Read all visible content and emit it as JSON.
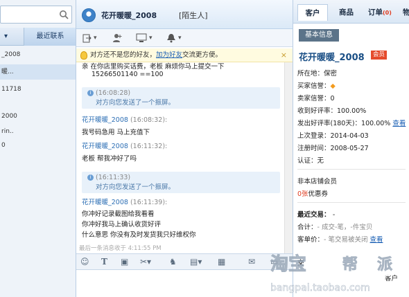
{
  "left": {
    "tab_recent": "最近联系",
    "contacts": [
      "_2008",
      "暖...",
      "11718",
      "2000",
      "rin..",
      "0"
    ]
  },
  "chat": {
    "name": "花开暖暖_2008",
    "tag": "[陌生人]",
    "notice_pre": "对方还不是您的好友，",
    "notice_link": "加为好友",
    "notice_post": "交流更方便。",
    "notice_close": "×",
    "partial_line": "亲  在你店里购买话费，老板   麻烦你马上提交一下",
    "messages": {
      "m0_text": "15266501140 ==100",
      "s1_time": "(16:08:28)",
      "s1_text": "对方向您发送了一个振屏。",
      "m1_sender": "花开暖暖_2008",
      "m1_time": "(16:08:32):",
      "m1_text": "我号码急用    马上充值下",
      "m2_sender": "花开暖暖_2008",
      "m2_time": "(16:11:32):",
      "m2_text": "老板    帮我冲好了吗",
      "s2_time": "(16:11:33)",
      "s2_text": "对方向您发送了一个振屏。",
      "m3_sender": "花开暖暖_2008",
      "m3_time": "(16:11:39):",
      "m3_l1": "你冲好记录截图给我看看",
      "m3_l2": "你冲好我马上确认收货好评",
      "m3_l3": "什么意思   你没有及时发货我只好维权你"
    },
    "last_line": "最后一条消息收于 4:11:55 PM"
  },
  "right": {
    "tabs": [
      "客户",
      "商品",
      "订单",
      "(0)",
      "物"
    ],
    "subtab": "基本信息",
    "name": "花开暖暖_2008",
    "badge": "会员",
    "location": "所在地：保密",
    "buyer_credit": "买家信誉：",
    "seller_credit": "卖家信誉：0",
    "received_rate": "收到好评率：100.00%",
    "sent_rate": "发出好评率(180天)：100.00%",
    "view1": "查看",
    "last_login": "上次登录：2014-04-03",
    "reg_time": "注册时间：2008-05-27",
    "auth": "认证：无",
    "member_type": "非本店铺会员",
    "coupon_count": "0张",
    "coupon_label": "优惠券",
    "recent_trade": "最近交易：",
    "recent_dash": "-",
    "total_label": "合计：",
    "total_value": "- 成交-笔，-件宝贝",
    "unit_price_label": "客单价：",
    "unit_price_value": "- 笔交易被关闭",
    "view2": "查看",
    "bottom1": "交",
    "bottom2": "客户"
  },
  "watermark": {
    "brand": "淘宝帮派",
    "url": "bangpai.taobao.com"
  }
}
